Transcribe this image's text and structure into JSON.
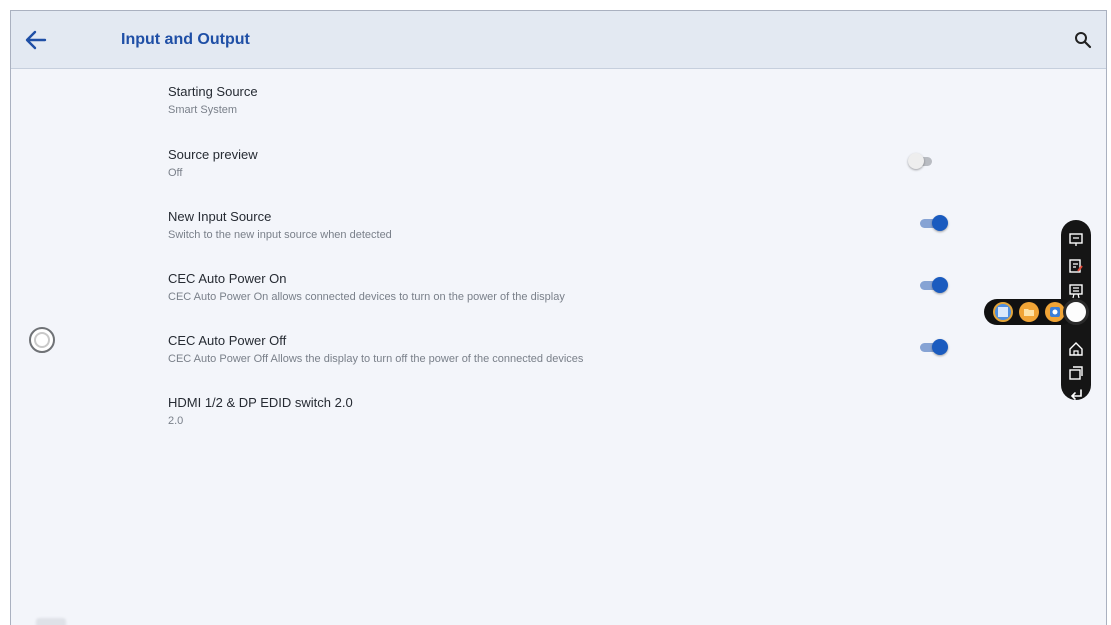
{
  "header": {
    "title": "Input and Output",
    "back_icon": "arrow-left-icon",
    "search_icon": "search-icon",
    "accent": "#1f4fa6"
  },
  "settings": [
    {
      "title": "Starting Source",
      "subtitle": "Smart System",
      "toggle": null
    },
    {
      "title": "Source preview",
      "subtitle": "Off",
      "toggle": "off"
    },
    {
      "title": "New Input Source",
      "subtitle": "Switch to the new input source when detected",
      "toggle": "on"
    },
    {
      "title": "CEC Auto Power On",
      "subtitle": "CEC Auto Power On allows connected devices to turn on the power of the display",
      "toggle": "on"
    },
    {
      "title": "CEC Auto Power Off",
      "subtitle": "CEC Auto Power Off Allows the display to turn off the power of the connected devices",
      "toggle": "on"
    },
    {
      "title": "HDMI 1/2 & DP EDID switch 2.0",
      "subtitle": "2.0",
      "toggle": null
    }
  ],
  "floating_toolbar": {
    "icons": [
      "whiteboard-icon",
      "annotate-icon",
      "present-icon",
      "home-icon",
      "windows-icon",
      "back-icon"
    ],
    "apps": [
      "file-manager-app-icon",
      "files-app-icon",
      "settings-app-icon"
    ]
  },
  "colors": {
    "toggle_on": "#1a5bbf",
    "toggle_on_track": "#86a3d4",
    "background": "#f3f5fa",
    "header_bg": "#e3e9f2"
  }
}
